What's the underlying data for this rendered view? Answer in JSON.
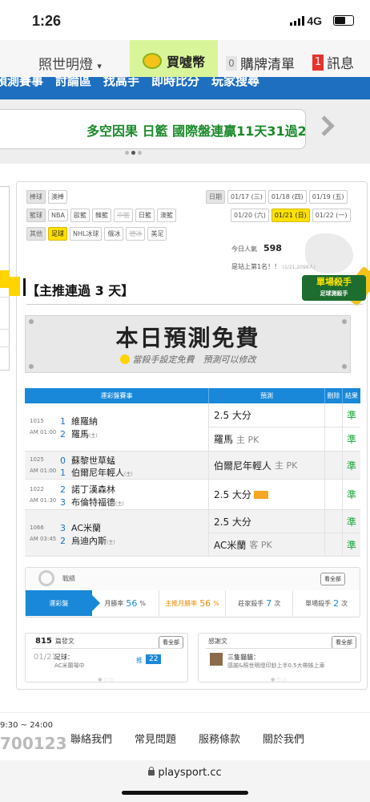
{
  "status": {
    "time": "1:26",
    "network": "4G"
  },
  "nav": {
    "user": "照世明燈",
    "buy": "買噓幣",
    "cart_count": "0",
    "cart": "購牌清單",
    "msg_count": "1",
    "msg": "訊息"
  },
  "banner": {
    "strip": "預測賽事　討論區　找高手　即時比分　玩家搜尋",
    "marquee": "多空因果 日籃 國際盤連贏11天31過21"
  },
  "filters": {
    "rows": [
      [
        "棒球",
        "澳棒"
      ],
      [
        "籃球",
        "NBA",
        "歐籃",
        "韓籃",
        "中籃",
        "日籃",
        "澳籃"
      ],
      [
        "其他",
        "足球",
        "NHL冰球",
        "俄冰",
        "德冰",
        "美足"
      ]
    ]
  },
  "dates": {
    "label": "日期",
    "row1": [
      "01/17 (三)",
      "01/18 (四)",
      "01/19 (五)"
    ],
    "row2": [
      "01/20 (六)",
      "01/21 (日)",
      "01/22 (一)"
    ]
  },
  "popularity": {
    "label": "今日人氣",
    "value": "598",
    "first": "是站上第1名！！",
    "first_small": "(1/21,2098人)"
  },
  "killer": {
    "title": "單場殺手",
    "sub": "足球測殺手"
  },
  "headline": "【主推連過 3 天】",
  "free": {
    "title": "本日預測免費",
    "sub": "當殺手設定免費　預測可以修改"
  },
  "table": {
    "headers": [
      "運彩盤賽事",
      "預測",
      "刪除",
      "結果"
    ],
    "matches": [
      {
        "id": "1015",
        "time": "AM 01:00",
        "n1": "1",
        "team1": "維羅納",
        "n2": "2",
        "team2": "羅馬",
        "team2_tag": "(主)",
        "pick1": "2.5 大分",
        "pick1_hint": "",
        "pick2": "羅馬",
        "pick2_hint": "主 PK",
        "res1": "準",
        "res2": "準"
      },
      {
        "id": "1025",
        "time": "AM 01:00",
        "n1": "0",
        "team1": "蘇黎世草蜢",
        "n2": "1",
        "team2": "伯爾尼年輕人",
        "team2_tag": "(主)",
        "pick1": "伯爾尼年輕人",
        "pick1_hint": "主 PK",
        "res1": "準"
      },
      {
        "id": "1022",
        "time": "AM 01:30",
        "n1": "2",
        "team1": "諾丁漢森林",
        "n2": "3",
        "team2": "布倫特福德",
        "team2_tag": "(主)",
        "pick1": "2.5 大分",
        "pick1_hint": "",
        "res1": "準"
      },
      {
        "id": "1066",
        "time": "AM 03:45",
        "n1": "3",
        "team1": "AC米蘭",
        "n2": "2",
        "team2": "烏迪內斯",
        "team2_tag": "(主)",
        "pick1": "2.5 大分",
        "pick1_hint": "",
        "pick2": "AC米蘭",
        "pick2_hint": "客 PK",
        "res1": "準",
        "res2": "準"
      }
    ]
  },
  "stats": {
    "title": "戰績",
    "see_all": "看全部",
    "tabs": [
      {
        "label": "運彩盤",
        "value": ""
      },
      {
        "label": "月勝率",
        "value": "56",
        "unit": "%"
      },
      {
        "label": "主推月勝率",
        "value": "56",
        "unit": "%"
      },
      {
        "label": "莊家殺手",
        "value": "7",
        "unit": "次"
      },
      {
        "label": "單場殺手",
        "value": "2",
        "unit": "次"
      }
    ]
  },
  "posts": {
    "count": "815",
    "label": "篇發文",
    "see_all": "看全部",
    "date": "01/21",
    "c1": "足球：",
    "c2": "AC米蘭場中",
    "push": "推",
    "push_count": "22"
  },
  "thanks": {
    "label": "感謝文",
    "see_all": "看全部",
    "c1": "三隻貓貓：",
    "c2": "感謝&照世明燈印鈔上半0.5大帶姊上車"
  },
  "footer": {
    "hours": "9:30 ~ 24:00",
    "phone": "700123",
    "links": [
      "聯絡我們",
      "常見問題",
      "服務條款",
      "關於我們"
    ],
    "url": "playsport.cc"
  }
}
